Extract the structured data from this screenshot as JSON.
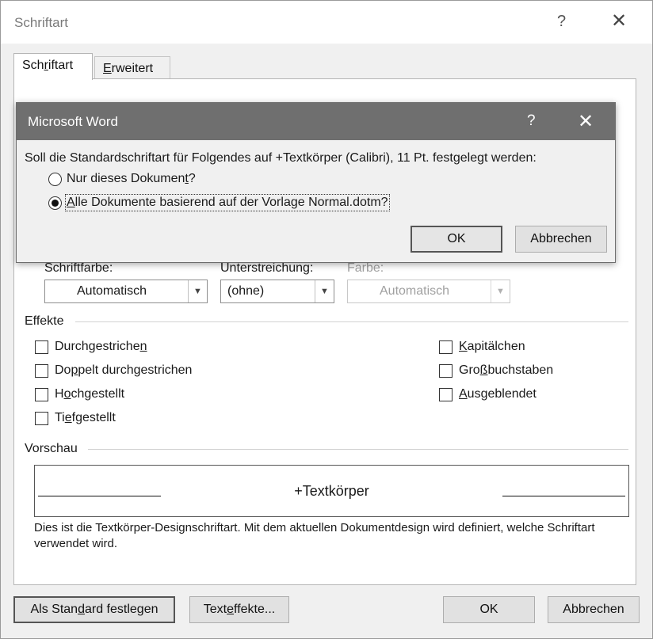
{
  "window": {
    "title": "Schriftart",
    "help": "?",
    "close": "✕"
  },
  "tabs": [
    {
      "pre": "Sch",
      "ul": "r",
      "post": "iftart"
    },
    {
      "pre": "",
      "ul": "E",
      "post": "rweitert"
    }
  ],
  "color_row": {
    "font_color": {
      "label": "Schriftfarbe:",
      "value": "Automatisch"
    },
    "underline": {
      "label": "Unterstreichung:",
      "value": "(ohne)"
    },
    "underline_color": {
      "label": "Farbe:",
      "value": "Automatisch"
    }
  },
  "effects": {
    "heading": "Effekte",
    "left": [
      {
        "pre": "Durchgestriche",
        "ul": "n",
        "post": ""
      },
      {
        "pre": "Do",
        "ul": "p",
        "post": "pelt durchgestrichen"
      },
      {
        "pre": "H",
        "ul": "o",
        "post": "chgestellt"
      },
      {
        "pre": "Ti",
        "ul": "e",
        "post": "fgestellt"
      }
    ],
    "right": [
      {
        "pre": "",
        "ul": "K",
        "post": "apitälchen"
      },
      {
        "pre": "Gro",
        "ul": "ß",
        "post": "buchstaben"
      },
      {
        "pre": "",
        "ul": "A",
        "post": "usgeblendet"
      }
    ]
  },
  "preview": {
    "heading": "Vorschau",
    "sample": "+Textkörper",
    "description": "Dies ist die Textkörper-Designschriftart. Mit dem aktuellen Dokumentdesign wird definiert, welche Schriftart verwendet wird."
  },
  "buttons": {
    "set_default": {
      "pre": "Als Stan",
      "ul": "d",
      "post": "ard festlegen"
    },
    "text_effects": {
      "pre": "Text",
      "ul": "e",
      "post": "ffekte..."
    },
    "ok": "OK",
    "cancel": "Abbrechen"
  },
  "modal": {
    "title": "Microsoft Word",
    "help": "?",
    "close": "✕",
    "message": "Soll die Standardschriftart für Folgendes auf +Textkörper (Calibri), 11 Pt. festgelegt werden:",
    "option1": {
      "pre": "Nur dieses Dokumen",
      "ul": "t",
      "post": "?"
    },
    "option2": {
      "pre": "",
      "ul": "A",
      "post": "lle Dokumente basierend auf der Vorlage Normal.dotm?"
    },
    "selected": "option2",
    "ok": "OK",
    "cancel": "Abbrechen"
  }
}
